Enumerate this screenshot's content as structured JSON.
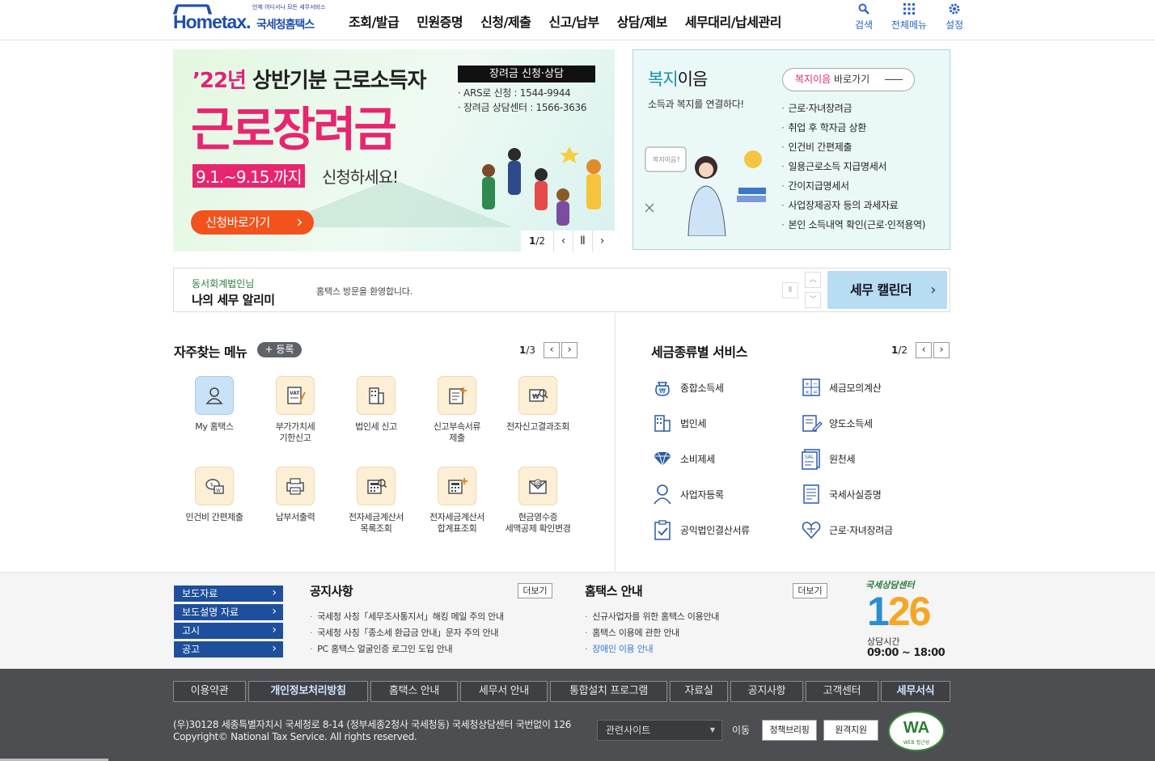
{
  "header": {
    "logo_small": "언제 어디서나 모든 세무서비스",
    "logo_home": "Hometax.",
    "logo_nts": "국세청홈택스",
    "nav": [
      "조회/발급",
      "민원증명",
      "신청/제출",
      "신고/납부",
      "상담/제보",
      "세무대리/납세관리"
    ],
    "util": [
      {
        "label": "검색",
        "icon": "search-icon"
      },
      {
        "label": "전체메뉴",
        "icon": "grid-icon"
      },
      {
        "label": "설정",
        "icon": "gear-icon"
      }
    ]
  },
  "banner": {
    "year": "’22년",
    "headline": "상반기분 근로소득자",
    "main": "근로장려금",
    "period": "9.1.~9.15.까지",
    "period_tail": "신청하세요!",
    "apply": "신청바로가기",
    "box_title": "장려금 신청·상담",
    "box_lines": [
      "· ARS로 신청 : 1544-9944",
      "· 장려금 상담센터 : 1566-3636"
    ],
    "pager": "1/2",
    "pager_cur": "1",
    "pager_total": "/2"
  },
  "welfare": {
    "title_hl": "복지",
    "title_rest": "이음",
    "sub": "소득과 복지를 연결하다!",
    "go_hl": "복지이음",
    "go_rest": " 바로가기",
    "items": [
      "근로·자녀장려금",
      "취업 후 학자금 상환",
      "인건비 간편제출",
      "일용근로소득 지급명세서",
      "간이지급명세서",
      "사업장제공자 등의 과세자료",
      "본인 소득내역 확인(근로·인적용역)"
    ],
    "fig_text": "복지이음?"
  },
  "alarm": {
    "who": "동서회계법인님",
    "name": "나의 세무 알리미",
    "message": "홈택스 방문을 환영합니다.",
    "calendar": "세무 캘린더"
  },
  "favorites": {
    "title": "자주찾는 메뉴",
    "register": "+ 등록",
    "page_cur": "1",
    "page_total": "/3",
    "items": [
      {
        "label": "My 홈택스",
        "icon": "person-icon"
      },
      {
        "label": "부가가치세\n기한신고",
        "icon": "vat-document-icon"
      },
      {
        "label": "법인세 신고",
        "icon": "building-icon"
      },
      {
        "label": "신고부속서류\n제출",
        "icon": "document-add-icon"
      },
      {
        "label": "전자신고결과조회",
        "icon": "won-search-icon"
      },
      {
        "label": "인건비 간편제출",
        "icon": "coin-submit-icon"
      },
      {
        "label": "납부서출력",
        "icon": "printer-icon"
      },
      {
        "label": "전자세금계산서\n목록조회",
        "icon": "calculator-search-icon"
      },
      {
        "label": "전자세금계산서\n합계표조회",
        "icon": "calculator-add-icon"
      },
      {
        "label": "현금영수증\n세액공제 확인변경",
        "icon": "mail-icon"
      }
    ]
  },
  "taxservices": {
    "title": "세금종류별 서비스",
    "page_cur": "1",
    "page_total": "/2",
    "items": [
      {
        "label": "종합소득세",
        "icon": "money-bag-icon"
      },
      {
        "label": "세금모의계산",
        "icon": "calculator-icon"
      },
      {
        "label": "법인세",
        "icon": "building-icon"
      },
      {
        "label": "양도소득세",
        "icon": "document-pen-icon"
      },
      {
        "label": "소비제세",
        "icon": "diamond-icon"
      },
      {
        "label": "원천세",
        "icon": "receipt-icon"
      },
      {
        "label": "사업자등록",
        "icon": "person-icon"
      },
      {
        "label": "국세사실증명",
        "icon": "certificate-icon"
      },
      {
        "label": "공익법인결산서류",
        "icon": "clipboard-check-icon"
      },
      {
        "label": "근로·자녀장려금",
        "icon": "heart-icon"
      }
    ]
  },
  "notice": {
    "press": [
      "보도자료",
      "보도설명 자료",
      "고시",
      "공고"
    ],
    "notice_title": "공지사항",
    "notice_more": "더보기",
    "notice_items": [
      "국세청 사칭「세무조사통지서」해킹 메일 주의 안내",
      "국세청 사칭「종소세 환급금 안내」문자 주의 안내",
      "PC 홈택스 얼굴인증 로그인 도입 안내"
    ],
    "guide_title": "홈택스 안내",
    "guide_more": "더보기",
    "guide_items": [
      "신규사업자를 위한 홈택스 이용안내",
      "홈택스 이용에 관한 안내",
      "장애인 이용 안내"
    ],
    "center_caption": "국세상담센터",
    "center_number_1": "1",
    "center_number_2": "2",
    "center_number_3": "6",
    "center_hours_label": "상담시간",
    "center_hours": "09:00 ~ 18:00"
  },
  "footer": {
    "menu": [
      "이용약관",
      "개인정보처리방침",
      "홈택스 안내",
      "세무서 안내",
      "통합설치 프로그램",
      "자료실",
      "공지사항",
      "고객센터",
      "세무서식"
    ],
    "address": "(우)30128 세종특별자치시 국세청로 8-14 (정부세종2청사 국세청동) 국세청상담센터 국번없이 126",
    "copyright": "Copyright© National Tax Service. All rights reserved.",
    "related": "관련사이트",
    "go": "이동",
    "badge1": "정책브리핑",
    "badge2": "원격지원",
    "wa_text": "WA",
    "wa_sub": "WEB 접근성"
  }
}
